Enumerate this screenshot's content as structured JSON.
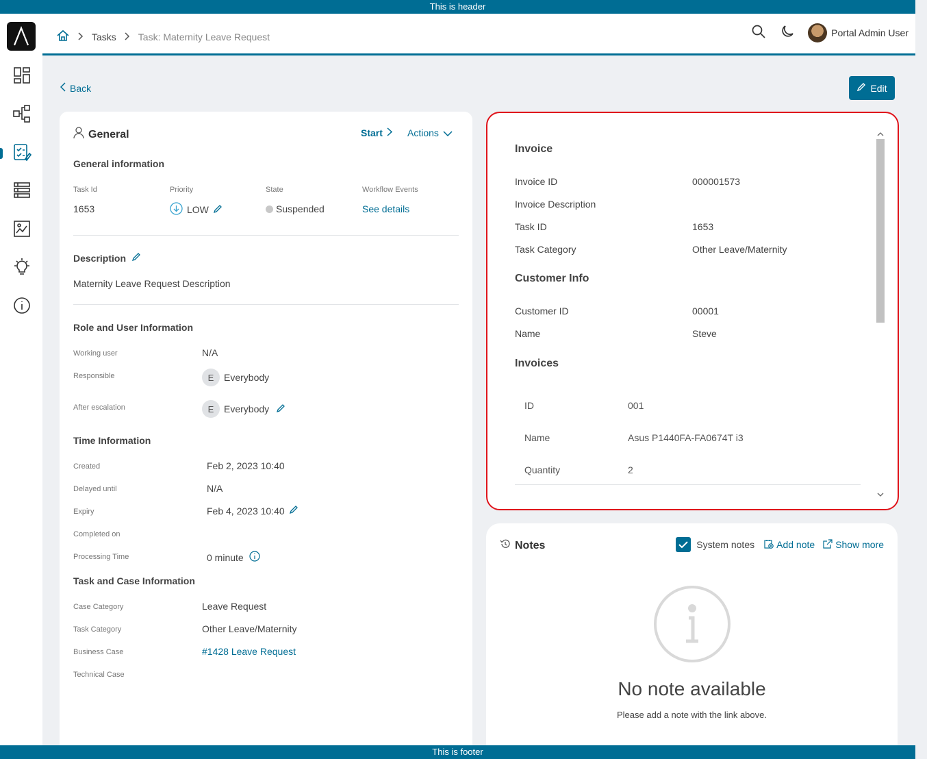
{
  "banner": {
    "header_text": "This is header",
    "footer_text": "This is footer"
  },
  "sidebar": {
    "items": [
      {
        "icon": "dashboard-icon"
      },
      {
        "icon": "process-icon"
      },
      {
        "icon": "tasks-icon",
        "active": true
      },
      {
        "icon": "cases-icon"
      },
      {
        "icon": "statistics-icon"
      },
      {
        "icon": "lightbulb-icon"
      },
      {
        "icon": "info-icon"
      }
    ]
  },
  "header": {
    "breadcrumb": {
      "home_icon": "home-icon",
      "tasks": "Tasks",
      "current": "Task: Maternity Leave Request"
    },
    "user_name": "Portal Admin User"
  },
  "toolbar": {
    "back_label": "Back",
    "edit_label": "Edit"
  },
  "general": {
    "title": "General",
    "start_label": "Start",
    "actions_label": "Actions",
    "info_title": "General information",
    "task_id_label": "Task Id",
    "task_id": "1653",
    "priority_label": "Priority",
    "priority": "LOW",
    "state_label": "State",
    "state": "Suspended",
    "workflow_label": "Workflow Events",
    "workflow_link": "See details",
    "description_title": "Description",
    "description": "Maternity Leave Request Description",
    "role_title": "Role and User Information",
    "working_user_label": "Working user",
    "working_user": "N/A",
    "responsible_label": "Responsible",
    "responsible_initial": "E",
    "responsible": "Everybody",
    "after_escalation_label": "After escalation",
    "after_escalation_initial": "E",
    "after_escalation": "Everybody",
    "time_title": "Time Information",
    "created_label": "Created",
    "created": "Feb 2, 2023 10:40",
    "delayed_label": "Delayed until",
    "delayed": "N/A",
    "expiry_label": "Expiry",
    "expiry": "Feb 4, 2023 10:40",
    "completed_label": "Completed on",
    "processing_label": "Processing Time",
    "processing": "0 minute",
    "case_title": "Task and Case Information",
    "case_category_label": "Case Category",
    "case_category": "Leave Request",
    "task_category_label": "Task Category",
    "task_category": "Other Leave/Maternity",
    "business_case_label": "Business Case",
    "business_case": "#1428 Leave Request",
    "technical_case_label": "Technical Case"
  },
  "invoice": {
    "title": "Invoice",
    "invoice_id_label": "Invoice ID",
    "invoice_id": "000001573",
    "invoice_desc_label": "Invoice Description",
    "task_id_label": "Task ID",
    "task_id": "1653",
    "task_category_label": "Task Category",
    "task_category": "Other Leave/Maternity",
    "customer_title": "Customer Info",
    "customer_id_label": "Customer ID",
    "customer_id": "00001",
    "name_label": "Name",
    "name": "Steve",
    "invoices_title": "Invoices",
    "rows": [
      {
        "label": "ID",
        "value": "001"
      },
      {
        "label": "Name",
        "value": "Asus P1440FA-FA0674T i3"
      },
      {
        "label": "Quantity",
        "value": "2"
      }
    ]
  },
  "notes": {
    "title": "Notes",
    "system_notes_label": "System notes",
    "add_note_label": "Add note",
    "show_more_label": "Show more",
    "empty_title": "No note available",
    "empty_hint": "Please add a note with the link above."
  },
  "colors": {
    "accent": "#006d94",
    "highlight_border": "#e0141b"
  }
}
